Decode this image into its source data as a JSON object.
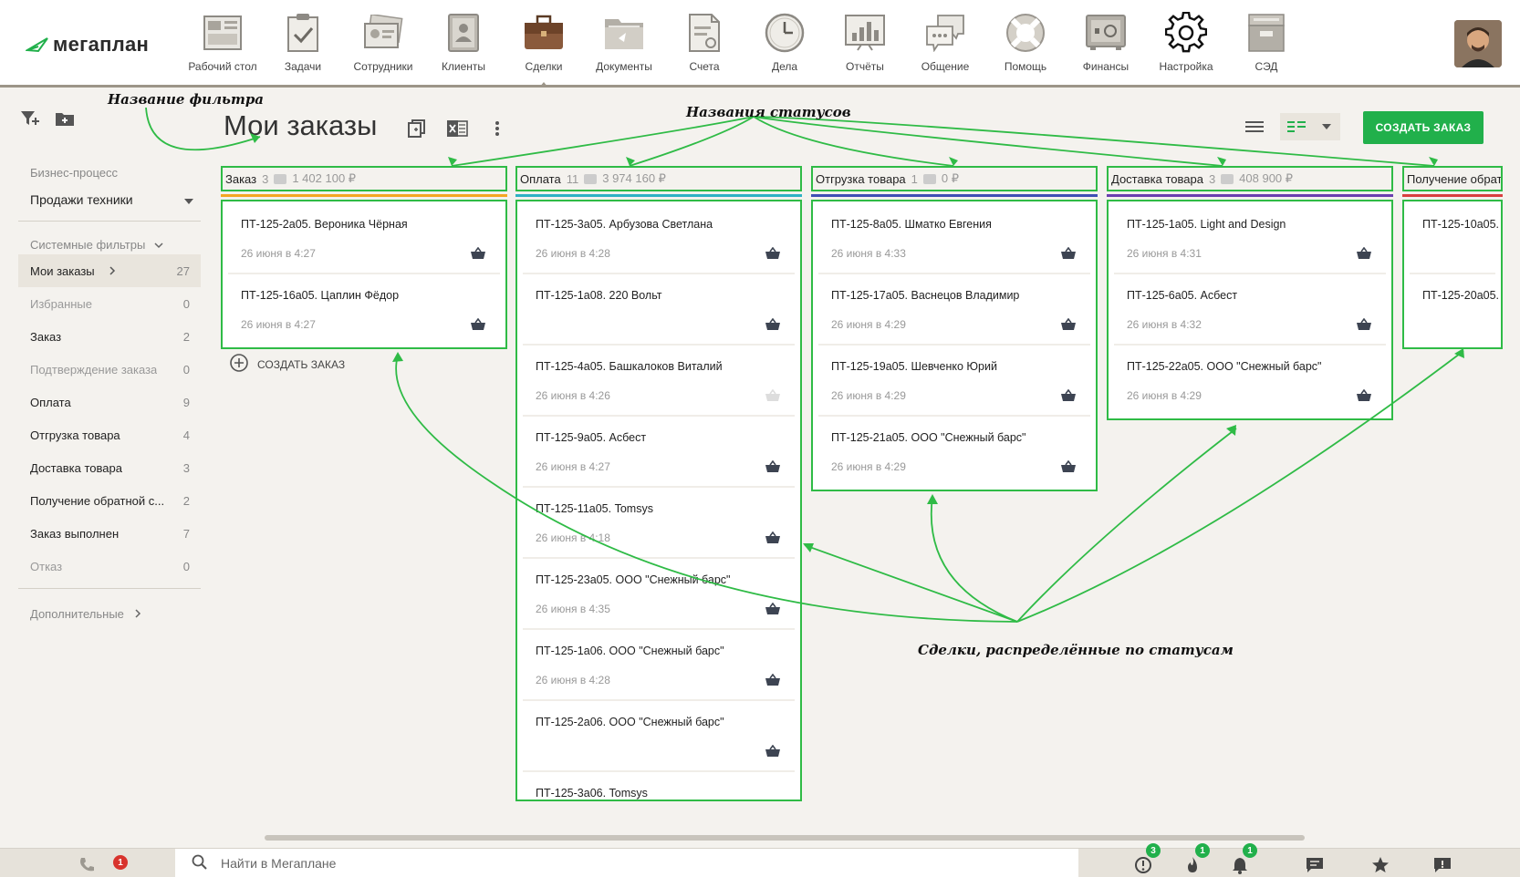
{
  "app": {
    "logo_text": "мегаплан"
  },
  "nav": [
    {
      "label": "Рабочий стол",
      "icon": "desktop-icon"
    },
    {
      "label": "Задачи",
      "icon": "tasks-icon"
    },
    {
      "label": "Сотрудники",
      "icon": "employees-icon"
    },
    {
      "label": "Клиенты",
      "icon": "clients-icon"
    },
    {
      "label": "Сделки",
      "icon": "deals-icon",
      "active": true
    },
    {
      "label": "Документы",
      "icon": "documents-icon"
    },
    {
      "label": "Счета",
      "icon": "invoices-icon"
    },
    {
      "label": "Дела",
      "icon": "clock-icon"
    },
    {
      "label": "Отчёты",
      "icon": "reports-icon"
    },
    {
      "label": "Общение",
      "icon": "chat-icon"
    },
    {
      "label": "Помощь",
      "icon": "help-icon"
    },
    {
      "label": "Финансы",
      "icon": "safe-icon"
    },
    {
      "label": "Настройка",
      "icon": "gear-icon"
    },
    {
      "label": "СЭД",
      "icon": "archive-icon"
    }
  ],
  "sidebar": {
    "process_label": "Бизнес-процесс",
    "process_value": "Продажи техники",
    "system_filters_label": "Системные фильтры",
    "filters": [
      {
        "name": "Мои заказы",
        "count": "27",
        "active": true
      },
      {
        "name": "Избранные",
        "count": "0",
        "muted": true
      },
      {
        "name": "Заказ",
        "count": "2"
      },
      {
        "name": "Подтверждение заказа",
        "count": "0",
        "muted": true
      },
      {
        "name": "Оплата",
        "count": "9"
      },
      {
        "name": "Отгрузка товара",
        "count": "4"
      },
      {
        "name": "Доставка товара",
        "count": "3"
      },
      {
        "name": "Получение обратной с...",
        "count": "2"
      },
      {
        "name": "Заказ выполнен",
        "count": "7"
      },
      {
        "name": "Отказ",
        "count": "0",
        "muted": true
      }
    ],
    "more_label": "Дополнительные"
  },
  "header": {
    "title": "Мои заказы",
    "create_button": "СОЗДАТЬ ЗАКАЗ"
  },
  "board": {
    "add_order_label": "СОЗДАТЬ ЗАКАЗ",
    "columns": [
      {
        "name": "Заказ",
        "count": "3",
        "sum": "1 402 100 ₽",
        "color": "#f5a623",
        "cards": [
          {
            "title": "ПТ-125-2а05. Вероника Чёрная",
            "date": "26 июня в 4:27"
          },
          {
            "title": "ПТ-125-16а05. Цаплин Фёдор",
            "date": "26 июня в 4:27"
          }
        ]
      },
      {
        "name": "Оплата",
        "count": "11",
        "sum": "3 974 160 ₽",
        "color": "#2fb1c4",
        "cards": [
          {
            "title": "ПТ-125-3а05. Арбузова Светлана",
            "date": "26 июня в 4:28"
          },
          {
            "title": "ПТ-125-1а08. 220 Вольт",
            "date": ""
          },
          {
            "title": "ПТ-125-4а05. Башкалоков Виталий",
            "date": "26 июня в 4:26",
            "faded": true
          },
          {
            "title": "ПТ-125-9а05. Асбест",
            "date": "26 июня в 4:27"
          },
          {
            "title": "ПТ-125-11а05. Tomsys",
            "date": "26 июня в 4:18"
          },
          {
            "title": "ПТ-125-23а05. ООО \"Снежный барс\"",
            "date": "26 июня в 4:35"
          },
          {
            "title": "ПТ-125-1а06. ООО \"Снежный барс\"",
            "date": "26 июня в 4:28"
          },
          {
            "title": "ПТ-125-2а06. ООО \"Снежный барс\"",
            "date": ""
          },
          {
            "title": "ПТ-125-3а06. Tomsys",
            "date": ""
          }
        ]
      },
      {
        "name": "Отгрузка товара",
        "count": "1",
        "sum": "0 ₽",
        "color": "#3f4fb5",
        "cards": [
          {
            "title": "ПТ-125-8а05. Шматко Евгения",
            "date": "26 июня в 4:33"
          },
          {
            "title": "ПТ-125-17а05. Васнецов Владимир",
            "date": "26 июня в 4:29"
          },
          {
            "title": "ПТ-125-19а05. Шевченко Юрий",
            "date": "26 июня в 4:29"
          },
          {
            "title": "ПТ-125-21а05. ООО \"Снежный барс\"",
            "date": "26 июня в 4:29"
          }
        ]
      },
      {
        "name": "Доставка товара",
        "count": "3",
        "sum": "408 900 ₽",
        "color": "#6a3fb0",
        "cards": [
          {
            "title": "ПТ-125-1а05. Light and Design",
            "date": "26 июня в 4:31"
          },
          {
            "title": "ПТ-125-6а05. Асбест",
            "date": "26 июня в 4:32"
          },
          {
            "title": "ПТ-125-22а05. ООО \"Снежный барс\"",
            "date": "26 июня в 4:29"
          }
        ]
      },
      {
        "name": "Получение обратной связи",
        "count": "",
        "sum": "",
        "color": "#d93f3f",
        "cards": [
          {
            "title": "ПТ-125-10а05.",
            "date": ""
          },
          {
            "title": "ПТ-125-20а05.",
            "date": ""
          }
        ]
      }
    ]
  },
  "annotations": {
    "filter_name": "Название фильтра",
    "status_names": "Названия статусов",
    "deals_by_status": "Сделки, распределённые по статусам"
  },
  "bottombar": {
    "search_placeholder": "Найти в Мегаплане",
    "phone_badge": "1",
    "alerts_badge": "3",
    "fire_badge": "1",
    "bell_badge": "1"
  },
  "colors": {
    "accent": "#21b04b",
    "highlight": "#2fbb46"
  }
}
